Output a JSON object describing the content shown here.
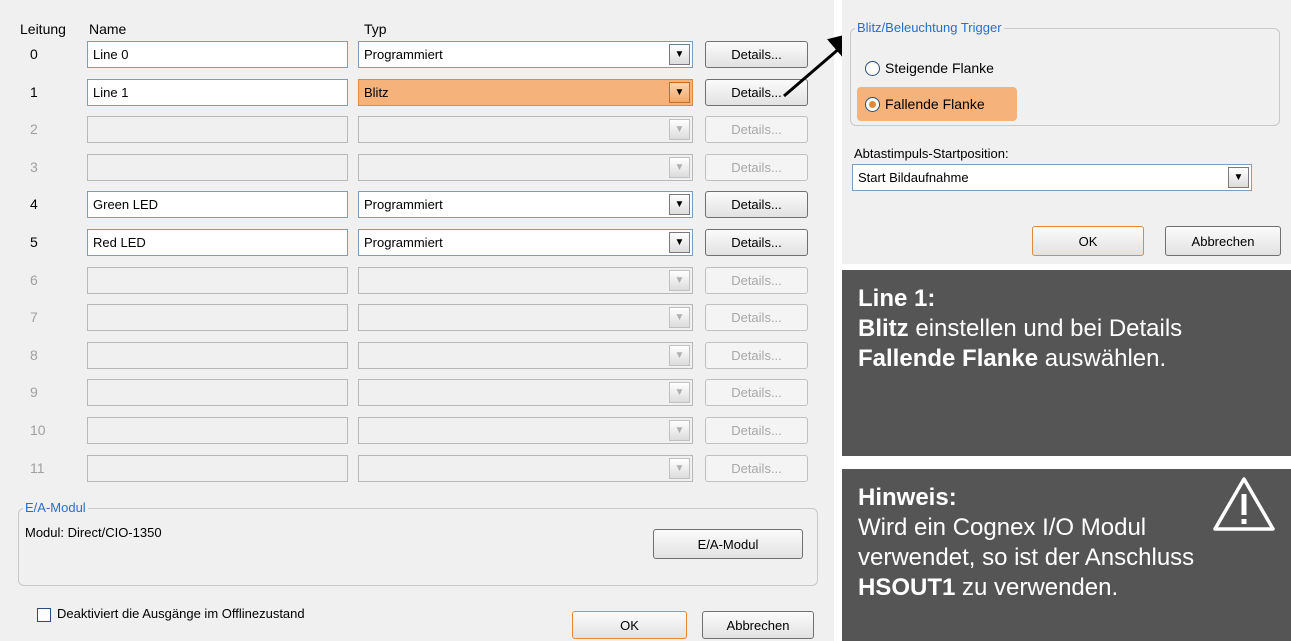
{
  "headers": {
    "line": "Leitung",
    "name": "Name",
    "type": "Typ"
  },
  "details_label": "Details...",
  "rows": [
    {
      "num": "0",
      "name": "Line 0",
      "type": "Programmiert"
    },
    {
      "num": "1",
      "name": "Line 1",
      "type": "Blitz"
    },
    {
      "num": "2",
      "name": "",
      "type": ""
    },
    {
      "num": "3",
      "name": "",
      "type": ""
    },
    {
      "num": "4",
      "name": "Green LED",
      "type": "Programmiert"
    },
    {
      "num": "5",
      "name": "Red LED",
      "type": "Programmiert"
    },
    {
      "num": "6",
      "name": "",
      "type": ""
    },
    {
      "num": "7",
      "name": "",
      "type": ""
    },
    {
      "num": "8",
      "name": "",
      "type": ""
    },
    {
      "num": "9",
      "name": "",
      "type": ""
    },
    {
      "num": "10",
      "name": "",
      "type": ""
    },
    {
      "num": "11",
      "name": "",
      "type": ""
    }
  ],
  "io_module": {
    "legend": "E/A-Modul",
    "module_text": "Modul: Direct/CIO-1350",
    "button": "E/A-Modul"
  },
  "offline_checkbox_label": "Deaktiviert die Ausgänge im Offlinezustand",
  "footer": {
    "ok": "OK",
    "cancel": "Abbrechen"
  },
  "details_dialog": {
    "group_title": "Blitz/Beleuchtung Trigger",
    "rising": "Steigende Flanke",
    "falling": "Fallende Flanke",
    "startpos_label": "Abtastimpuls-Startposition:",
    "startpos_value": "Start Bildaufnahme",
    "ok": "OK",
    "cancel": "Abbrechen"
  },
  "note1": {
    "line1": "Line 1:",
    "bold1": "Blitz",
    "text1": " einstellen und bei Details",
    "bold2": "Fallende Flanke",
    "text2": " auswählen."
  },
  "note2": {
    "title": "Hinweis:",
    "text_line1": "Wird ein Cognex I/O Modul",
    "text_line2": "verwendet, so ist der Anschluss",
    "bold": "HSOUT1",
    "text_line3": " zu verwenden."
  },
  "colors": {
    "highlight": "#f5b27a",
    "note_bg": "#555555",
    "legend": "#2a6ecc"
  }
}
